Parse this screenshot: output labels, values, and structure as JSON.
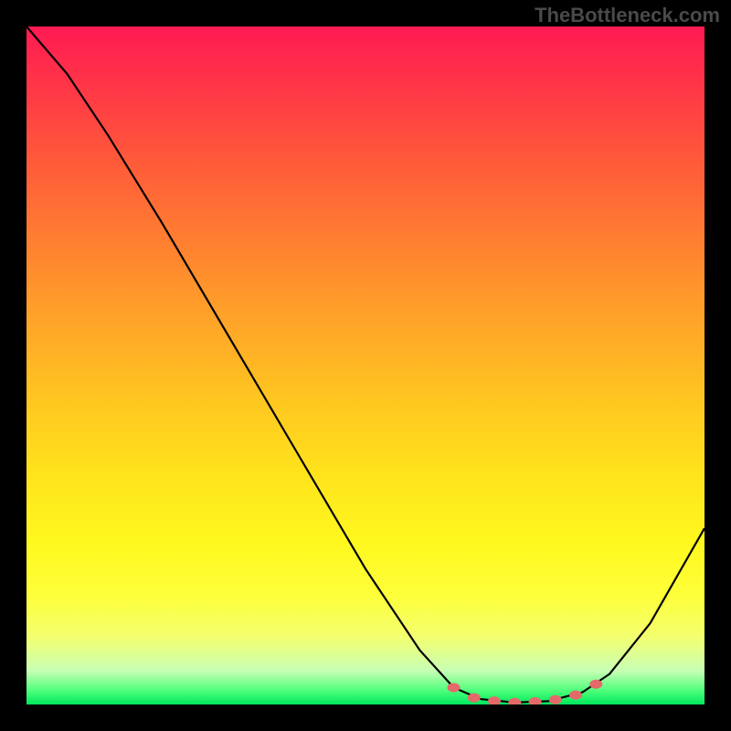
{
  "watermark": "TheBottleneck.com",
  "chart_data": {
    "type": "line",
    "title": "",
    "xlabel": "",
    "ylabel": "",
    "xlim": [
      0,
      100
    ],
    "ylim": [
      0,
      100
    ],
    "curve": [
      {
        "x": 0,
        "y": 100
      },
      {
        "x": 6,
        "y": 93
      },
      {
        "x": 12,
        "y": 84
      },
      {
        "x": 20,
        "y": 71
      },
      {
        "x": 30,
        "y": 54
      },
      {
        "x": 40,
        "y": 37
      },
      {
        "x": 50,
        "y": 20
      },
      {
        "x": 58,
        "y": 8
      },
      {
        "x": 63,
        "y": 2.5
      },
      {
        "x": 67,
        "y": 0.8
      },
      {
        "x": 72,
        "y": 0.3
      },
      {
        "x": 77,
        "y": 0.5
      },
      {
        "x": 82,
        "y": 1.8
      },
      {
        "x": 86,
        "y": 4.5
      },
      {
        "x": 92,
        "y": 12
      },
      {
        "x": 100,
        "y": 26
      }
    ],
    "highlight_points": [
      {
        "x": 63,
        "y": 2.5
      },
      {
        "x": 66,
        "y": 1.0
      },
      {
        "x": 69,
        "y": 0.5
      },
      {
        "x": 72,
        "y": 0.3
      },
      {
        "x": 75,
        "y": 0.4
      },
      {
        "x": 78,
        "y": 0.7
      },
      {
        "x": 81,
        "y": 1.4
      },
      {
        "x": 84,
        "y": 3.0
      }
    ],
    "highlight_color": "#e46a6a",
    "gradient_stops": [
      {
        "pos": 0,
        "color": "#ff1a53"
      },
      {
        "pos": 50,
        "color": "#ffc321"
      },
      {
        "pos": 90,
        "color": "#f4ff70"
      },
      {
        "pos": 100,
        "color": "#00e85c"
      }
    ]
  }
}
